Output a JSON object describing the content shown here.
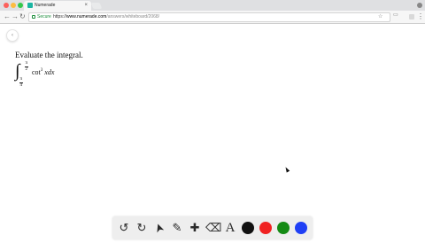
{
  "browser": {
    "tab_title": "Numerade",
    "tab_close": "×",
    "secure_label": "Secure",
    "url_scheme": "https://",
    "url_host": "www.numerade.com",
    "url_path": "/answers/whiteboard/2068/"
  },
  "nav": {
    "back": "←",
    "forward": "→",
    "reload": "↻"
  },
  "content": {
    "back_button": "‹",
    "question": "Evaluate the integral.",
    "integral_sign": "∫",
    "upper_num": "π",
    "upper_den": "2",
    "lower_num": "π",
    "lower_den": "4",
    "func": "cot",
    "power": "3",
    "var": "xdx"
  },
  "whiteboard_toolbar": {
    "tools": [
      {
        "name": "undo-icon",
        "glyph": "↺"
      },
      {
        "name": "redo-icon",
        "glyph": "↻"
      },
      {
        "name": "pointer-icon",
        "glyph": "➤"
      },
      {
        "name": "pencil-icon",
        "glyph": "✎"
      },
      {
        "name": "add-icon",
        "glyph": "✚"
      },
      {
        "name": "eraser-icon",
        "glyph": "⌫"
      },
      {
        "name": "text-icon",
        "glyph": "A"
      }
    ],
    "colors": {
      "black": "#111111",
      "red": "#f02222",
      "green": "#148a14",
      "blue": "#1f3ff5"
    }
  }
}
